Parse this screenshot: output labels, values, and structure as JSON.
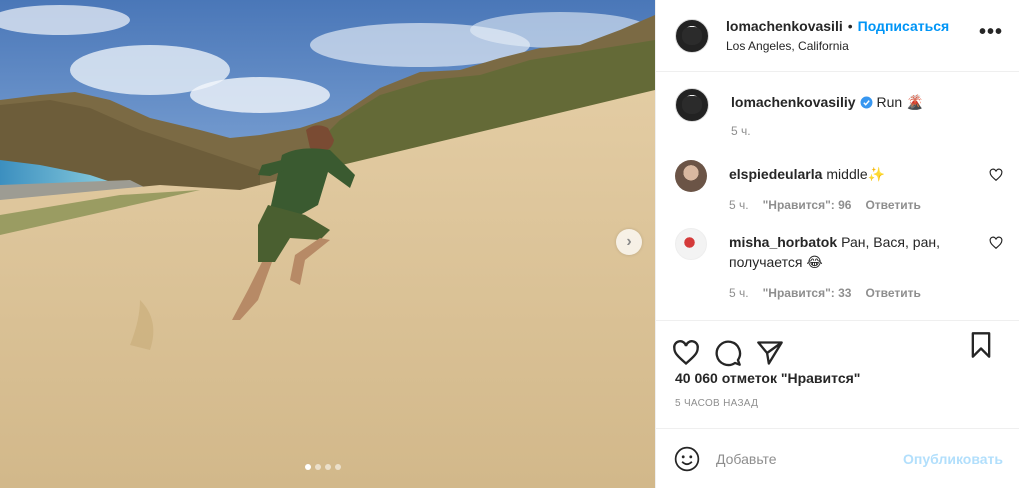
{
  "post": {
    "username": "lomachenkovasili",
    "separator": "•",
    "follow_label": "Подписаться",
    "location": "Los Angeles, California",
    "more_label": "•••"
  },
  "caption": {
    "username": "lomachenkovasiliy",
    "verified": true,
    "text": "Run 🌋",
    "time": "5 ч."
  },
  "comments": [
    {
      "username": "elspiedeularla",
      "text": "middle✨",
      "time": "5 ч.",
      "likes": "\"Нравится\": 96",
      "reply": "Ответить"
    },
    {
      "username": "misha_horbatok",
      "text": "Ран, Вася, ран, получается 😂",
      "time": "5 ч.",
      "likes": "\"Нравится\": 33",
      "reply": "Ответить"
    }
  ],
  "likes_count": "40 060 отметок \"Нравится\"",
  "posted_ago": "5 ЧАСОВ НАЗАД",
  "add_comment": {
    "placeholder": "Добавьте",
    "publish_label": "Опубликовать"
  },
  "carousel": {
    "slides": 4,
    "active": 1,
    "next_icon": "chevron-right-icon"
  },
  "colors": {
    "link": "#0095f6",
    "publish_disabled": "#b2dffc",
    "verified": "#3897f0",
    "muted": "#8e8e8e"
  },
  "icons": [
    "heart-icon",
    "comment-icon",
    "share-icon",
    "bookmark-icon",
    "emoji-icon",
    "verified-icon"
  ]
}
